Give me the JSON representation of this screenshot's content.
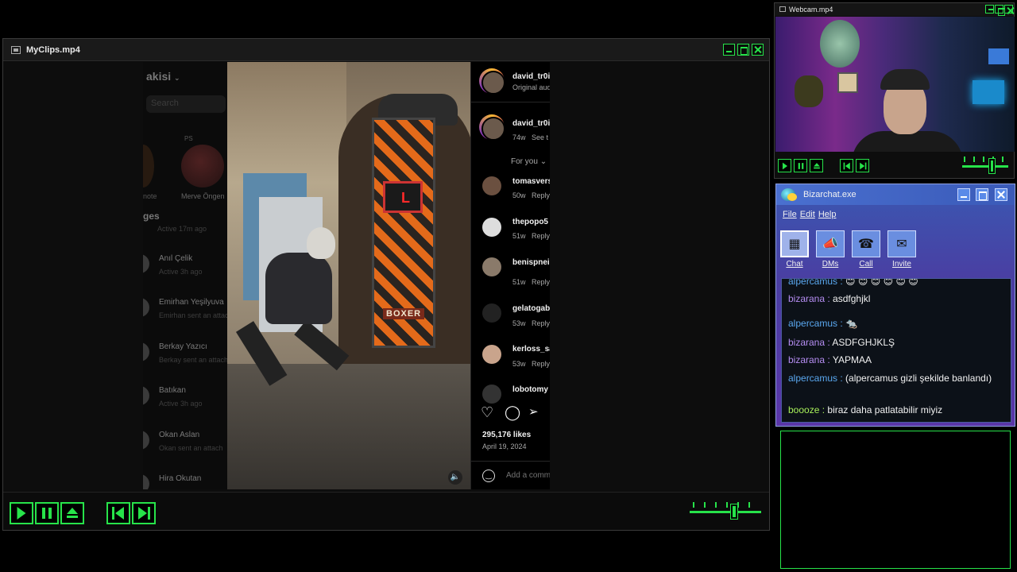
{
  "myclips": {
    "title": "MyClips.mp4",
    "instagram": {
      "username": "akisi",
      "search_placeholder": "Search",
      "note_ps": "PS",
      "story_note_label": "note",
      "story_name": "Merve Öngen",
      "messages_label": "ges",
      "first_active": "Active 17m ago",
      "chats": [
        {
          "name": "Anıl Çelik",
          "sub": "Active 3h ago"
        },
        {
          "name": "Emirhan Yeşilyuva",
          "sub": "Emirhan sent an attach"
        },
        {
          "name": "Berkay Yazıcı",
          "sub": "Berkay sent an attach"
        },
        {
          "name": "Batıkan",
          "sub": "Active 3h ago"
        },
        {
          "name": "Okan Aslan",
          "sub": "Okan sent an attach"
        },
        {
          "name": "Hira Okutan",
          "sub": ""
        }
      ],
      "video_sign": "BOXER",
      "post": {
        "author": "david_tr0i",
        "audio": "Original aud",
        "caption_author": "david_tr0i",
        "caption_meta": "74w",
        "caption_see": "See t",
        "for_you": "For you",
        "comments": [
          {
            "name": "tomasvers",
            "time": "50w",
            "reply": "Reply"
          },
          {
            "name": "thepopo5",
            "time": "51w",
            "reply": "Reply"
          },
          {
            "name": "benispnei",
            "time": "51w",
            "reply": "Reply"
          },
          {
            "name": "gelatogab",
            "time": "53w",
            "reply": "Reply"
          },
          {
            "name": "kerloss_sa",
            "time": "53w",
            "reply": "Reply"
          },
          {
            "name": "lobotomy",
            "time": "",
            "reply": ""
          }
        ],
        "likes": "295,176 likes",
        "date": "April 19, 2024",
        "add_comment_placeholder": "Add a comm"
      }
    }
  },
  "webcam": {
    "title": "Webcam.mp4"
  },
  "bizarchat": {
    "title": "Bizarchat.exe",
    "menu": [
      "File",
      "Edit",
      "Help"
    ],
    "tools": [
      {
        "label": "Chat",
        "icon": "chat-icon"
      },
      {
        "label": "DMs",
        "icon": "megaphone-icon"
      },
      {
        "label": "Call",
        "icon": "call-icon"
      },
      {
        "label": "Invite",
        "icon": "invite-icon"
      }
    ],
    "messages": [
      {
        "nick": "alpercamus",
        "text": "😊 😊 😊 😊 😊 😊",
        "color": "blue"
      },
      {
        "nick": "bizarana",
        "text": "asdfghjkl",
        "color": "purple"
      },
      {
        "nick": "alpercamus",
        "text": "🐀",
        "color": "blue"
      },
      {
        "nick": "bizarana",
        "text": "ASDFGHJKLŞ",
        "color": "purple"
      },
      {
        "nick": "bizarana",
        "text": "YAPMAA",
        "color": "purple"
      },
      {
        "nick": "alpercamus",
        "text": "(alpercamus gizli şekilde banlandı)",
        "color": "blue"
      },
      {
        "nick": "boooze",
        "text": "biraz daha patlatabilir miyiz",
        "color": "green"
      }
    ],
    "separator": " : "
  },
  "colors": {
    "accent_green": "#27e34a",
    "bizarchat_blue": "#3a58b2",
    "nick_blue": "#5aa8f0",
    "nick_purple": "#b58df2",
    "nick_green": "#a8f05a"
  }
}
